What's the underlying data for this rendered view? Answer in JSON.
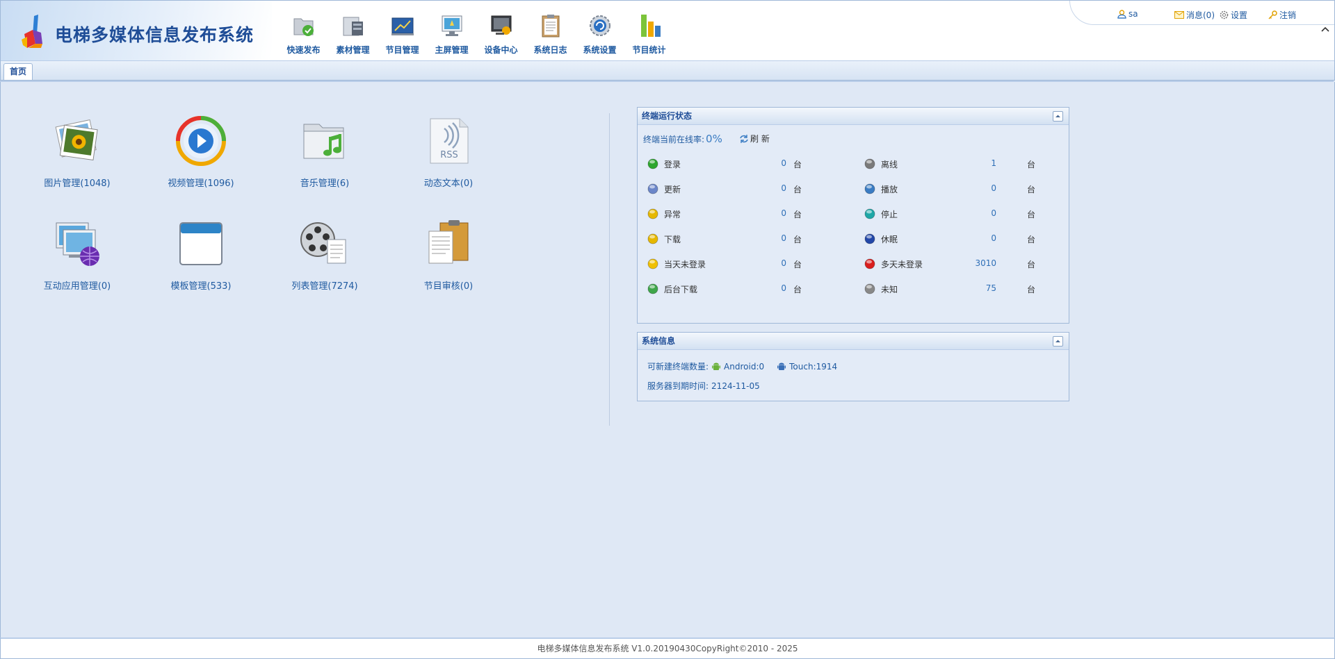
{
  "app": {
    "title": "电梯多媒体信息发布系统"
  },
  "topnav": [
    {
      "label": "快速发布",
      "icon": "quick-publish-icon"
    },
    {
      "label": "素材管理",
      "icon": "material-icon"
    },
    {
      "label": "节目管理",
      "icon": "program-icon"
    },
    {
      "label": "主屏管理",
      "icon": "main-screen-icon"
    },
    {
      "label": "设备中心",
      "icon": "device-icon"
    },
    {
      "label": "系统日志",
      "icon": "log-icon"
    },
    {
      "label": "系统设置",
      "icon": "settings-icon"
    },
    {
      "label": "节目统计",
      "icon": "stats-icon"
    }
  ],
  "user": {
    "name": "sa",
    "messages": "消息(0)",
    "settings": "设置",
    "logout": "注销"
  },
  "tabs": [
    {
      "label": "首页"
    }
  ],
  "shortcuts": [
    {
      "label": "图片管理(1048)",
      "icon": "photo-icon"
    },
    {
      "label": "视频管理(1096)",
      "icon": "video-icon"
    },
    {
      "label": "音乐管理(6)",
      "icon": "music-icon"
    },
    {
      "label": "动态文本(0)",
      "icon": "rss-icon"
    },
    {
      "label": "互动应用管理(0)",
      "icon": "interactive-icon"
    },
    {
      "label": "模板管理(533)",
      "icon": "template-icon"
    },
    {
      "label": "列表管理(7274)",
      "icon": "film-list-icon"
    },
    {
      "label": "节目审核(0)",
      "icon": "clipboard-icon"
    }
  ],
  "terminal_panel": {
    "title": "终端运行状态",
    "online_label": "终端当前在线率:",
    "online_rate": "0%",
    "refresh_label": "刷 新",
    "unit": "台",
    "left": [
      {
        "name": "登录",
        "count": "0",
        "color": "#2ea62e",
        "icon": "login-status-icon"
      },
      {
        "name": "更新",
        "count": "0",
        "color": "#6b86c9",
        "icon": "update-status-icon"
      },
      {
        "name": "异常",
        "count": "0",
        "color": "#e6b800",
        "icon": "exception-status-icon"
      },
      {
        "name": "下载",
        "count": "0",
        "color": "#e6b800",
        "icon": "download-status-icon"
      },
      {
        "name": "当天未登录",
        "count": "0",
        "color": "#f0c000",
        "icon": "not-logged-today-icon"
      },
      {
        "name": "后台下载",
        "count": "0",
        "color": "#3fa64a",
        "icon": "background-download-icon"
      }
    ],
    "right": [
      {
        "name": "离线",
        "count": "1",
        "color": "#7a7a7a",
        "icon": "offline-status-icon"
      },
      {
        "name": "播放",
        "count": "0",
        "color": "#3a7cc3",
        "icon": "play-status-icon"
      },
      {
        "name": "停止",
        "count": "0",
        "color": "#1fa7a7",
        "icon": "stop-status-icon"
      },
      {
        "name": "休眠",
        "count": "0",
        "color": "#2347a8",
        "icon": "sleep-status-icon"
      },
      {
        "name": "多天未登录",
        "count": "3010",
        "color": "#d91e1e",
        "icon": "not-logged-days-icon"
      },
      {
        "name": "未知",
        "count": "75",
        "color": "#888888",
        "icon": "unknown-status-icon"
      }
    ]
  },
  "system_panel": {
    "title": "系统信息",
    "new_terminal_label": "可新建终端数量:",
    "android": "Android:0",
    "touch": "Touch:1914",
    "expiry_label": "服务器到期时间:",
    "expiry_date": "2124-11-05"
  },
  "footer": {
    "text": "电梯多媒体信息发布系统 V1.0.20190430CopyRight©2010 - 2025"
  }
}
